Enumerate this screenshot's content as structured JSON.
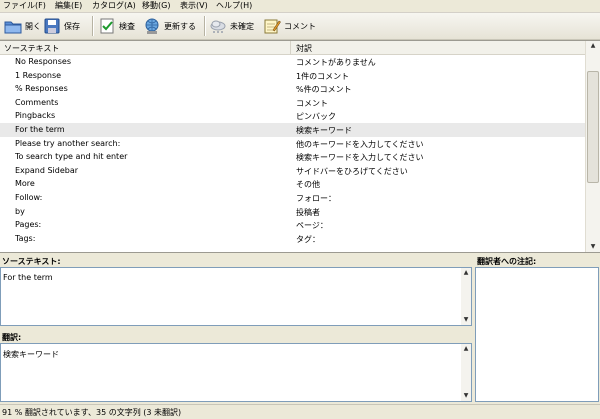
{
  "menu": [
    "ファイル(F)",
    "編集(E)",
    "カタログ(A)",
    "移動(G)",
    "表示(V)",
    "ヘルプ(H)"
  ],
  "toolbar": {
    "open": "開く",
    "save": "保存",
    "validate": "検査",
    "update": "更新する",
    "fuzzy": "未確定",
    "comment": "コメント"
  },
  "table": {
    "headers": [
      "ソーステキスト",
      "対訳"
    ],
    "rows": [
      {
        "source": "No Responses",
        "translation": "コメントがありません"
      },
      {
        "source": "1 Response",
        "translation": "1件のコメント"
      },
      {
        "source": "% Responses",
        "translation": "%件のコメント"
      },
      {
        "source": "Comments",
        "translation": "コメント"
      },
      {
        "source": "Pingbacks",
        "translation": "ピンバック"
      },
      {
        "source": "For the term",
        "translation": "検索キーワード"
      },
      {
        "source": "Please try another search:",
        "translation": "他のキーワードを入力してください"
      },
      {
        "source": "To search type and hit enter",
        "translation": "検索キーワードを入力してください"
      },
      {
        "source": "Expand Sidebar",
        "translation": "サイドバーをひろげてください"
      },
      {
        "source": "More",
        "translation": "その他"
      },
      {
        "source": "Follow:",
        "translation": "フォロー："
      },
      {
        "source": "by",
        "translation": "投稿者"
      },
      {
        "source": "Pages:",
        "translation": "ページ："
      },
      {
        "source": "Tags:",
        "translation": "タグ："
      }
    ],
    "selected_index": 5
  },
  "source_pane": {
    "label": "ソーステキスト:",
    "value": "For the term"
  },
  "translation_pane": {
    "label": "翻訳:",
    "value": "検索キーワード"
  },
  "notes_pane": {
    "label": "翻訳者への注記:"
  },
  "status": "91 % 翻訳されています、35 の文字列 (3 未翻訳)"
}
